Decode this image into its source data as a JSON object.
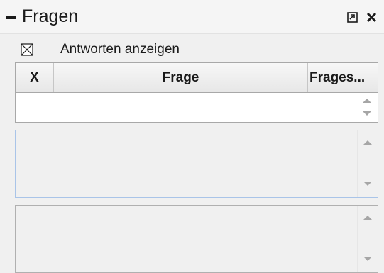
{
  "panel": {
    "title": "Fragen",
    "restore_icon": "restore-window-icon",
    "close_icon": "close-icon",
    "collapse_icon": "collapse-minus-icon"
  },
  "options": {
    "show_answers_label": "Antworten anzeigen",
    "show_answers_checked": true
  },
  "table": {
    "columns": [
      "X",
      "Frage",
      "Frages..."
    ],
    "rows": []
  },
  "colors": {
    "focus_border": "#a9c4e8",
    "scroll_arrow": "#a6a6a6"
  }
}
